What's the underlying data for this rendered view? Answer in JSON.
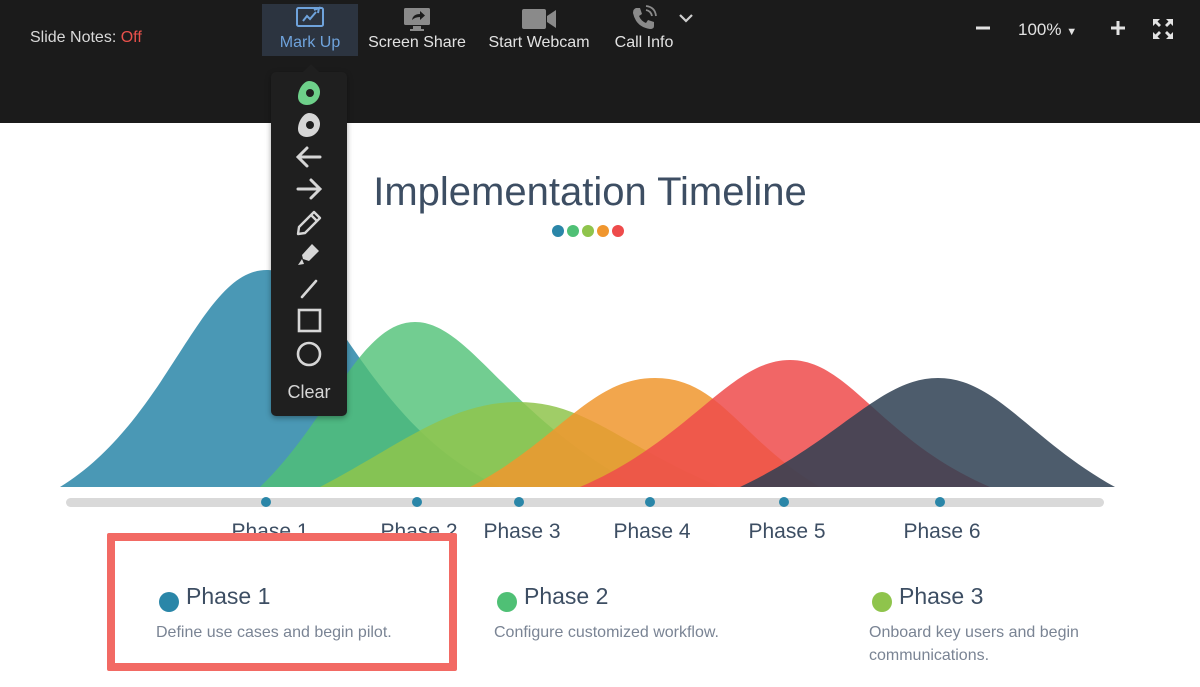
{
  "toolbar": {
    "slide_notes_label": "Slide Notes:",
    "slide_notes_state": "Off",
    "buttons": {
      "markup": "Mark Up",
      "screen_share": "Screen Share",
      "start_webcam": "Start Webcam",
      "call_info": "Call Info"
    },
    "zoom": "100%",
    "icons": {
      "markup": "markup-icon",
      "screen_share": "screen-share-icon",
      "webcam": "webcam-icon",
      "call_info": "phone-icon",
      "more": "chevron-down-icon",
      "zoom_out": "minus-icon",
      "zoom_in": "plus-icon",
      "fullscreen": "fullscreen-icon"
    }
  },
  "markup_panel": {
    "tools": [
      "highlighter-pointer",
      "pointer",
      "arrow-left",
      "arrow-right",
      "pencil",
      "highlighter",
      "line",
      "rectangle",
      "circle"
    ],
    "clear_label": "Clear"
  },
  "slide": {
    "title": "Implementation Timeline",
    "phase_labels": [
      "Phase 1",
      "Phase 2",
      "Phase 3",
      "Phase 4",
      "Phase 5",
      "Phase 6"
    ],
    "cards": [
      {
        "title": "Phase 1",
        "desc": "Define use cases and begin pilot.",
        "color": "#2a86a8"
      },
      {
        "title": "Phase 2",
        "desc": "Configure customized workflow.",
        "color": "#4fc075"
      },
      {
        "title": "Phase 3",
        "desc": "Onboard key users and begin communications.",
        "color": "#8fc44c"
      }
    ],
    "colors": {
      "phase1": "#2a86a8",
      "phase2": "#4fc075",
      "phase3": "#8fc44c",
      "phase4": "#f0962e",
      "phase5": "#ee4b4b",
      "phase6": "#2e3f52",
      "highlight": "#f26a64"
    }
  }
}
